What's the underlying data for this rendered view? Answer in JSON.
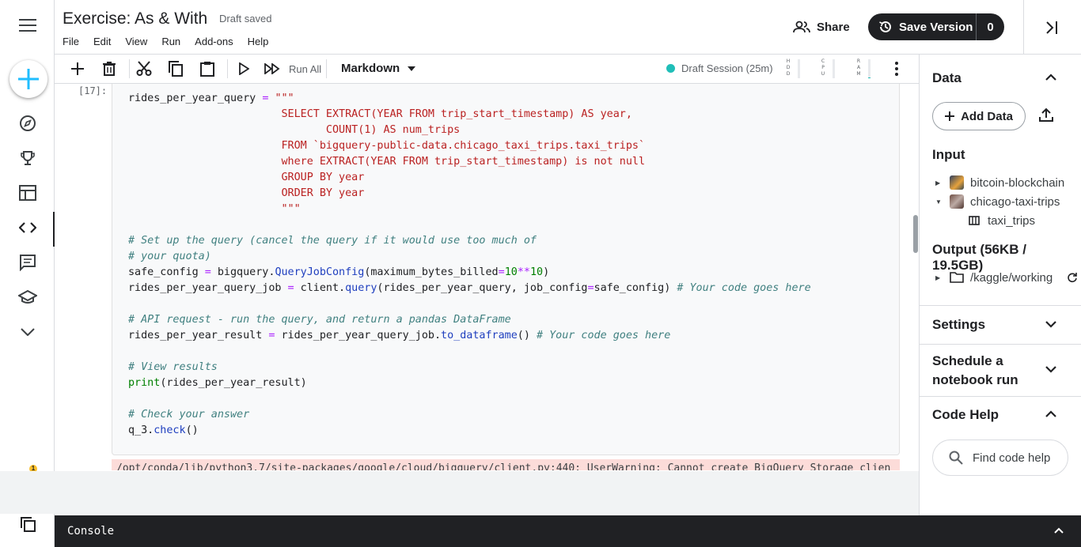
{
  "header": {
    "title": "Exercise: As & With",
    "draft_status": "Draft saved",
    "menu": [
      "File",
      "Edit",
      "View",
      "Run",
      "Add-ons",
      "Help"
    ],
    "share_label": "Share",
    "save_version_label": "Save Version",
    "save_version_count": "0"
  },
  "rail": {
    "icons": [
      "menu-icon",
      "create-icon",
      "compass-icon",
      "trophy-icon",
      "table-icon",
      "code-icon",
      "comment-icon",
      "school-icon",
      "chevron-down-icon"
    ],
    "notification_count": "1"
  },
  "toolbar": {
    "run_all_label": "Run All",
    "cell_type": "Markdown",
    "session_label": "Draft Session (25m)",
    "meters": [
      {
        "label": "HDD",
        "level": 0.0
      },
      {
        "label": "CPU",
        "level": 0.0
      },
      {
        "label": "RAM",
        "level": 0.05
      }
    ],
    "session_color": "#20beb8"
  },
  "notebook": {
    "execution_count": "[17]:",
    "code_lines": [
      "rides_per_year_query = \"\"\"",
      "                        SELECT EXTRACT(YEAR FROM trip_start_timestamp) AS year,",
      "                               COUNT(1) AS num_trips",
      "                        FROM `bigquery-public-data.chicago_taxi_trips.taxi_trips`",
      "                        where EXTRACT(YEAR FROM trip_start_timestamp) is not null",
      "                        GROUP BY year",
      "                        ORDER BY year",
      "                        \"\"\"",
      "",
      "# Set up the query (cancel the query if it would use too much of",
      "# your quota)",
      "safe_config = bigquery.QueryJobConfig(maximum_bytes_billed=10**10)",
      "rides_per_year_query_job = client.query(rides_per_year_query, job_config=safe_config) # Your code goes here",
      "",
      "# API request - run the query, and return a pandas DataFrame",
      "rides_per_year_result = rides_per_year_query_job.to_dataframe() # Your code goes here",
      "",
      "# View results",
      "print(rides_per_year_result)",
      "",
      "# Check your answer",
      "q_3.check()"
    ],
    "output_text": "/opt/conda/lib/python3.7/site-packages/google/cloud/bigquery/client.py:440: UserWarning: Cannot create BigQuery Storage clien"
  },
  "console": {
    "label": "Console"
  },
  "panel": {
    "data_heading": "Data",
    "add_data_label": "Add Data",
    "input_heading": "Input",
    "inputs": [
      {
        "name": "bitcoin-blockchain",
        "expanded": false
      },
      {
        "name": "chicago-taxi-trips",
        "expanded": true
      }
    ],
    "table_name": "taxi_trips",
    "output_heading": "Output (56KB / 19.5GB)",
    "output_path": "/kaggle/working",
    "settings_heading": "Settings",
    "schedule_heading": "Schedule a notebook run",
    "code_help_heading": "Code Help",
    "find_code_help": "Find code help"
  }
}
